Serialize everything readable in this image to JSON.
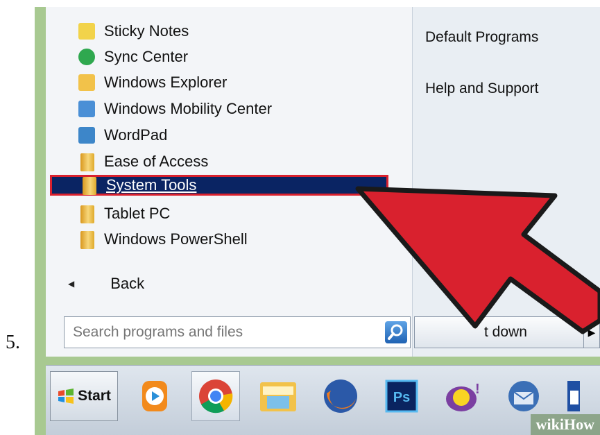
{
  "step_number": "5.",
  "programs": [
    {
      "label": "Sticky Notes",
      "icon": "sticky-notes-icon"
    },
    {
      "label": "Sync Center",
      "icon": "sync-center-icon"
    },
    {
      "label": "Windows Explorer",
      "icon": "windows-explorer-icon"
    },
    {
      "label": "Windows Mobility Center",
      "icon": "mobility-center-icon"
    },
    {
      "label": "WordPad",
      "icon": "wordpad-icon"
    },
    {
      "label": "Ease of Access",
      "icon": "folder-icon"
    },
    {
      "label": "System Tools",
      "icon": "folder-icon",
      "selected": true
    },
    {
      "label": "Tablet PC",
      "icon": "folder-icon"
    },
    {
      "label": "Windows PowerShell",
      "icon": "folder-icon"
    }
  ],
  "back_label": "Back",
  "search": {
    "placeholder": "Search programs and files"
  },
  "right_links": [
    "Default Programs",
    "Help and Support"
  ],
  "shutdown_label": "t down",
  "taskbar": {
    "start_label": "Start",
    "apps": [
      "media-player-icon",
      "chrome-icon",
      "file-explorer-icon",
      "firefox-icon",
      "photoshop-icon",
      "yahoo-messenger-icon",
      "thunderbird-icon",
      "document-icon"
    ]
  },
  "watermark": "wikiHow",
  "colors": {
    "selection": "#0a2463",
    "highlight_border": "#d9212e",
    "arrow": "#d9212e",
    "frame": "#a8c991"
  }
}
